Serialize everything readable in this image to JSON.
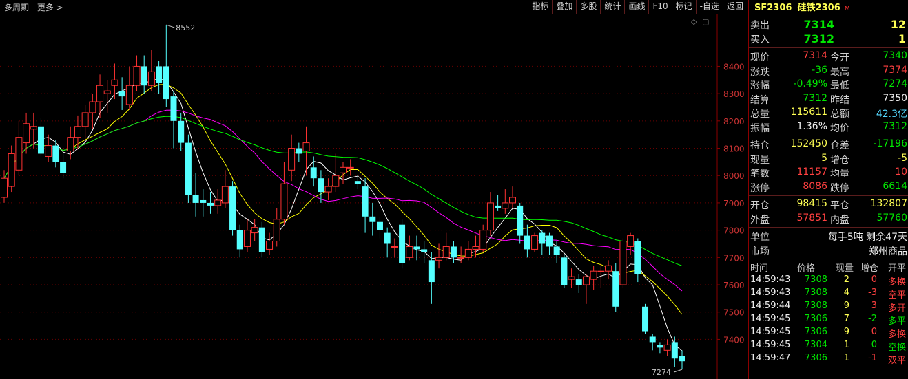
{
  "topbar": {
    "period": "多周期",
    "more": "更多 >"
  },
  "toolbar": [
    "指标",
    "叠加",
    "多股",
    "统计",
    "画线",
    "F10",
    "标记",
    "-自选",
    "返回"
  ],
  "header": {
    "code": "SF2306",
    "name": "硅铁2306",
    "flag": "M"
  },
  "orderbook": [
    {
      "label": "卖出",
      "price": "7314",
      "vol": "12"
    },
    {
      "label": "买入",
      "price": "7312",
      "vol": "1"
    }
  ],
  "quote": [
    {
      "l1": "现价",
      "v1": "7314",
      "c1": "red",
      "l2": "今开",
      "v2": "7340",
      "c2": "green"
    },
    {
      "l1": "涨跌",
      "v1": "-36",
      "c1": "green",
      "l2": "最高",
      "v2": "7374",
      "c2": "red"
    },
    {
      "l1": "涨幅",
      "v1": "-0.49%",
      "c1": "green",
      "l2": "最低",
      "v2": "7274",
      "c2": "green"
    },
    {
      "l1": "结算",
      "v1": "7312",
      "c1": "green",
      "l2": "昨结",
      "v2": "7350",
      "c2": "white"
    },
    {
      "l1": "总量",
      "v1": "115611",
      "c1": "yellow",
      "l2": "总额",
      "v2": "42.3亿",
      "c2": "cyan"
    },
    {
      "l1": "振幅",
      "v1": "1.36%",
      "c1": "white",
      "l2": "均价",
      "v2": "7312",
      "c2": "green"
    }
  ],
  "position": [
    {
      "l1": "持仓",
      "v1": "152450",
      "c1": "yellow",
      "l2": "仓差",
      "v2": "-17196",
      "c2": "green"
    },
    {
      "l1": "现量",
      "v1": "5",
      "c1": "yellow",
      "l2": "增仓",
      "v2": "-5",
      "c2": "yellow"
    },
    {
      "l1": "笔数",
      "v1": "11157",
      "c1": "red",
      "l2": "均量",
      "v2": "10",
      "c2": "red"
    },
    {
      "l1": "涨停",
      "v1": "8086",
      "c1": "red",
      "l2": "跌停",
      "v2": "6614",
      "c2": "green"
    }
  ],
  "flow": [
    {
      "l1": "开仓",
      "v1": "98415",
      "c1": "yellow",
      "l2": "平仓",
      "v2": "132807",
      "c2": "yellow"
    },
    {
      "l1": "外盘",
      "v1": "57851",
      "c1": "red",
      "l2": "内盘",
      "v2": "57760",
      "c2": "green"
    }
  ],
  "info": [
    {
      "label": "单位",
      "value": "每手5吨  剩余47天"
    },
    {
      "label": "市场",
      "value": "郑州商品"
    }
  ],
  "ticks_header": {
    "time": "时间",
    "price": "价格",
    "vol": "现量",
    "oi": "增仓",
    "type": "开平"
  },
  "ticks": [
    {
      "time": "14:59:43",
      "price": "7308",
      "vol": "2",
      "oi": "0",
      "type": "多换",
      "tc": "red",
      "oic": "red"
    },
    {
      "time": "14:59:43",
      "price": "7308",
      "vol": "4",
      "oi": "-3",
      "type": "空平",
      "tc": "red",
      "oic": "red"
    },
    {
      "time": "14:59:44",
      "price": "7308",
      "vol": "9",
      "oi": "3",
      "type": "多开",
      "tc": "red",
      "oic": "red"
    },
    {
      "time": "14:59:45",
      "price": "7306",
      "vol": "7",
      "oi": "-2",
      "type": "多平",
      "tc": "green",
      "oic": "green"
    },
    {
      "time": "14:59:45",
      "price": "7306",
      "vol": "9",
      "oi": "0",
      "type": "多换",
      "tc": "red",
      "oic": "red"
    },
    {
      "time": "14:59:45",
      "price": "7304",
      "vol": "1",
      "oi": "0",
      "type": "空换",
      "tc": "green",
      "oic": "green"
    },
    {
      "time": "14:59:47",
      "price": "7306",
      "vol": "1",
      "oi": "-1",
      "type": "双平",
      "tc": "red",
      "oic": "red"
    }
  ],
  "chart_data": {
    "type": "candlestick",
    "y_axis_labels": [
      8400,
      8300,
      8200,
      8100,
      8000,
      7900,
      7800,
      7700,
      7600,
      7500,
      7400
    ],
    "ylim": [
      7255,
      8590
    ],
    "high_marker": "8552",
    "low_marker": "7274",
    "colors": {
      "up": "#ff3232",
      "down": "#54ffff",
      "ma1": "#ffffff",
      "ma2": "#ffff00",
      "ma3": "#ff00ff",
      "ma4": "#00ff00"
    },
    "candles": [
      [
        7920,
        7990,
        7900,
        8020
      ],
      [
        7960,
        8080,
        7940,
        8110
      ],
      [
        8020,
        8140,
        8000,
        8200
      ],
      [
        8120,
        8190,
        8080,
        8230
      ],
      [
        8170,
        8180,
        8100,
        8230
      ],
      [
        8180,
        8080,
        8070,
        8210
      ],
      [
        8070,
        8110,
        8050,
        8150
      ],
      [
        8110,
        8050,
        8030,
        8130
      ],
      [
        8050,
        8010,
        7990,
        8080
      ],
      [
        8090,
        8140,
        8060,
        8180
      ],
      [
        8140,
        8180,
        8100,
        8220
      ],
      [
        8180,
        8230,
        8130,
        8260
      ],
      [
        8230,
        8270,
        8170,
        8300
      ],
      [
        8270,
        8330,
        8210,
        8370
      ],
      [
        8300,
        8310,
        8230,
        8350
      ],
      [
        8330,
        8350,
        8280,
        8410
      ],
      [
        8310,
        8290,
        8240,
        8360
      ],
      [
        8260,
        8330,
        8240,
        8400
      ],
      [
        8330,
        8400,
        8310,
        8440
      ],
      [
        8400,
        8330,
        8300,
        8440
      ],
      [
        8330,
        8380,
        8310,
        8460
      ],
      [
        8400,
        8340,
        8300,
        8420
      ],
      [
        8400,
        8280,
        8250,
        8552
      ],
      [
        8290,
        8200,
        8100,
        8310
      ],
      [
        8200,
        8120,
        8090,
        8230
      ],
      [
        8120,
        7930,
        7900,
        8150
      ],
      [
        7930,
        7900,
        7850,
        8010
      ],
      [
        7910,
        7900,
        7850,
        7950
      ],
      [
        7900,
        7890,
        7860,
        7940
      ],
      [
        7890,
        7910,
        7860,
        7950
      ],
      [
        7900,
        7960,
        7880,
        8020
      ],
      [
        7960,
        7800,
        7780,
        7980
      ],
      [
        7800,
        7730,
        7700,
        7820
      ],
      [
        7740,
        7800,
        7720,
        7840
      ],
      [
        7790,
        7810,
        7760,
        7840
      ],
      [
        7810,
        7720,
        7700,
        7830
      ],
      [
        7730,
        7760,
        7710,
        7790
      ],
      [
        7760,
        7840,
        7740,
        7880
      ],
      [
        7840,
        7970,
        7820,
        8050
      ],
      [
        8020,
        8100,
        7980,
        8150
      ],
      [
        8100,
        8080,
        8050,
        8120
      ],
      [
        8090,
        8120,
        8000,
        8180
      ],
      [
        8030,
        7990,
        7960,
        8070
      ],
      [
        7990,
        7940,
        7900,
        8020
      ],
      [
        7940,
        7960,
        7910,
        7990
      ],
      [
        7960,
        8000,
        7940,
        8080
      ],
      [
        8010,
        8030,
        7970,
        8050
      ],
      [
        8030,
        8030,
        8000,
        8060
      ],
      [
        7980,
        7970,
        7950,
        8000
      ],
      [
        7960,
        7850,
        7790,
        7990
      ],
      [
        7850,
        7830,
        7780,
        7900
      ],
      [
        7830,
        7800,
        7770,
        7850
      ],
      [
        7790,
        7750,
        7700,
        7810
      ],
      [
        7740,
        7740,
        7700,
        7770
      ],
      [
        7820,
        7680,
        7660,
        7840
      ],
      [
        7700,
        7740,
        7690,
        7780
      ],
      [
        7740,
        7730,
        7690,
        7780
      ],
      [
        7730,
        7720,
        7680,
        7760
      ],
      [
        7690,
        7610,
        7530,
        7720
      ],
      [
        7690,
        7700,
        7660,
        7750
      ],
      [
        7700,
        7740,
        7690,
        7790
      ],
      [
        7740,
        7700,
        7680,
        7760
      ],
      [
        7700,
        7700,
        7680,
        7740
      ],
      [
        7700,
        7730,
        7690,
        7760
      ],
      [
        7730,
        7740,
        7700,
        7780
      ],
      [
        7730,
        7800,
        7720,
        7820
      ],
      [
        7800,
        7900,
        7780,
        7940
      ],
      [
        7890,
        7880,
        7870,
        7930
      ],
      [
        7880,
        7900,
        7860,
        7950
      ],
      [
        7900,
        7920,
        7880,
        7960
      ],
      [
        7890,
        7780,
        7750,
        7900
      ],
      [
        7780,
        7730,
        7700,
        7820
      ],
      [
        7730,
        7780,
        7720,
        7790
      ],
      [
        7790,
        7750,
        7710,
        7800
      ],
      [
        7780,
        7740,
        7710,
        7790
      ],
      [
        7740,
        7710,
        7680,
        7760
      ],
      [
        7700,
        7600,
        7590,
        7710
      ],
      [
        7620,
        7630,
        7590,
        7660
      ],
      [
        7620,
        7600,
        7570,
        7640
      ],
      [
        7600,
        7630,
        7530,
        7640
      ],
      [
        7620,
        7650,
        7580,
        7670
      ],
      [
        7650,
        7650,
        7590,
        7680
      ],
      [
        7650,
        7670,
        7620,
        7690
      ],
      [
        7650,
        7520,
        7500,
        7680
      ],
      [
        7600,
        7760,
        7590,
        7770
      ],
      [
        7740,
        7780,
        7710,
        7790
      ],
      [
        7760,
        7640,
        7610,
        7770
      ],
      [
        7520,
        7430,
        7420,
        7530
      ],
      [
        7410,
        7390,
        7360,
        7420
      ],
      [
        7380,
        7370,
        7350,
        7390
      ],
      [
        7360,
        7380,
        7340,
        7400
      ],
      [
        7390,
        7330,
        7300,
        7410
      ],
      [
        7340,
        7320,
        7290,
        7360
      ]
    ]
  }
}
